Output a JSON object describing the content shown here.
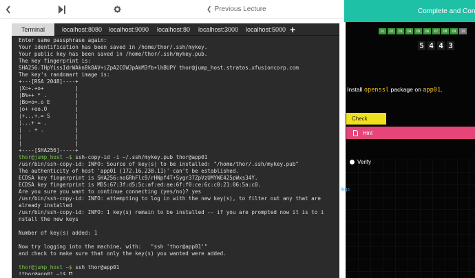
{
  "topbar": {
    "prev_lecture": "Previous Lecture",
    "complete_label": "Complete and Continue"
  },
  "terminal": {
    "tabs": [
      {
        "label": "Terminal"
      },
      {
        "label": "localhost:8080"
      },
      {
        "label": "localhost:9090"
      },
      {
        "label": "localhost:80"
      },
      {
        "label": "localhost:3000"
      },
      {
        "label": "localhost:5000"
      }
    ],
    "add_tab": "+",
    "lines": [
      {
        "text": "Enter same passphrase again:"
      },
      {
        "text": "Your identification has been saved in /home/thor/.ssh/mykey."
      },
      {
        "text": "Your public key has been saved in /home/thor/.ssh/mykey.pub."
      },
      {
        "text": "The key fingerprint is:"
      },
      {
        "text": "SHA256:THpYissIdrWAkn8k8AV+iZpA2COWJpAkM3fb+lhBUPY thor@jump_host.stratos.xfusioncorp.com"
      },
      {
        "text": "The key's randomart image is:"
      },
      {
        "text": "+---[RSA 2048]----+"
      },
      {
        "text": "|X=+.+o+          |"
      },
      {
        "text": "|B%++ * .         |"
      },
      {
        "text": "|Bo=o=.o E        |"
      },
      {
        "text": "|o+ +oo.O         |"
      },
      {
        "text": "|+...+.= S        |"
      },
      {
        "text": "|...+ = .         |"
      },
      {
        "text": "|  . + .          |"
      },
      {
        "text": "|                 |"
      },
      {
        "text": "|                 |"
      },
      {
        "text": "+----[SHA256]-----+"
      },
      {
        "prompt": "thor@jump_host ~$",
        "text": " ssh-copy-id -i ~/.ssh/mykey.pub thor@app01"
      },
      {
        "text": "/usr/bin/ssh-copy-id: INFO: Source of key(s) to be installed: \"/home/thor/.ssh/mykey.pub\""
      },
      {
        "text": "The authenticity of host 'app01 (172.16.238.11)' can't be established."
      },
      {
        "text": "ECDSA key fingerprint is SHA256:noGRhFlc9/rHNpf4T+Sygr37ZpVzUMYWE425pWxs34Y."
      },
      {
        "text": "ECDSA key fingerprint is MD5:67:3f:d5:5c:af:ed:ae:6f:f0:ce:6c:c0:21:06:5a:c0."
      },
      {
        "text": "Are you sure you want to continue connecting (yes/no)? yes"
      },
      {
        "text": "/usr/bin/ssh-copy-id: INFO: attempting to log in with the new key(s), to filter out any that are"
      },
      {
        "text": "already installed"
      },
      {
        "text": "/usr/bin/ssh-copy-id: INFO: 1 key(s) remain to be installed -- if you are prompted now it is to i"
      },
      {
        "text": "nstall the new keys"
      },
      {
        "text": ""
      },
      {
        "text": "Number of key(s) added: 1"
      },
      {
        "text": ""
      },
      {
        "text": "Now try logging into the machine, with:   \"ssh 'thor@app01'\""
      },
      {
        "text": "and check to make sure that only the key(s) you wanted were added."
      },
      {
        "text": ""
      },
      {
        "prompt": "thor@jump_host ~$",
        "text": " ssh thor@app01"
      },
      {
        "text": "[thor@app01 ~]$ ",
        "cursor": true
      }
    ]
  },
  "panel": {
    "questions": [
      "01",
      "02",
      "03",
      "04",
      "05",
      "06",
      "07",
      "08",
      "09",
      "10"
    ],
    "timer": [
      "5",
      "4",
      "4",
      "3"
    ],
    "task_pre": "Install ",
    "task_pkg": "openssl",
    "task_mid": " package on ",
    "task_host": "app01",
    "task_post": ".",
    "check_label": "Check",
    "hint_label": "Hint",
    "verify_label": "Verify"
  },
  "logs_label": "logs",
  "colors": {
    "accent": "#1ec0a6",
    "prompt": "#7dc94b",
    "check": "#f0e01e",
    "hint": "#e6457a",
    "code": "#f2c417",
    "question": "#3a9a3a"
  }
}
